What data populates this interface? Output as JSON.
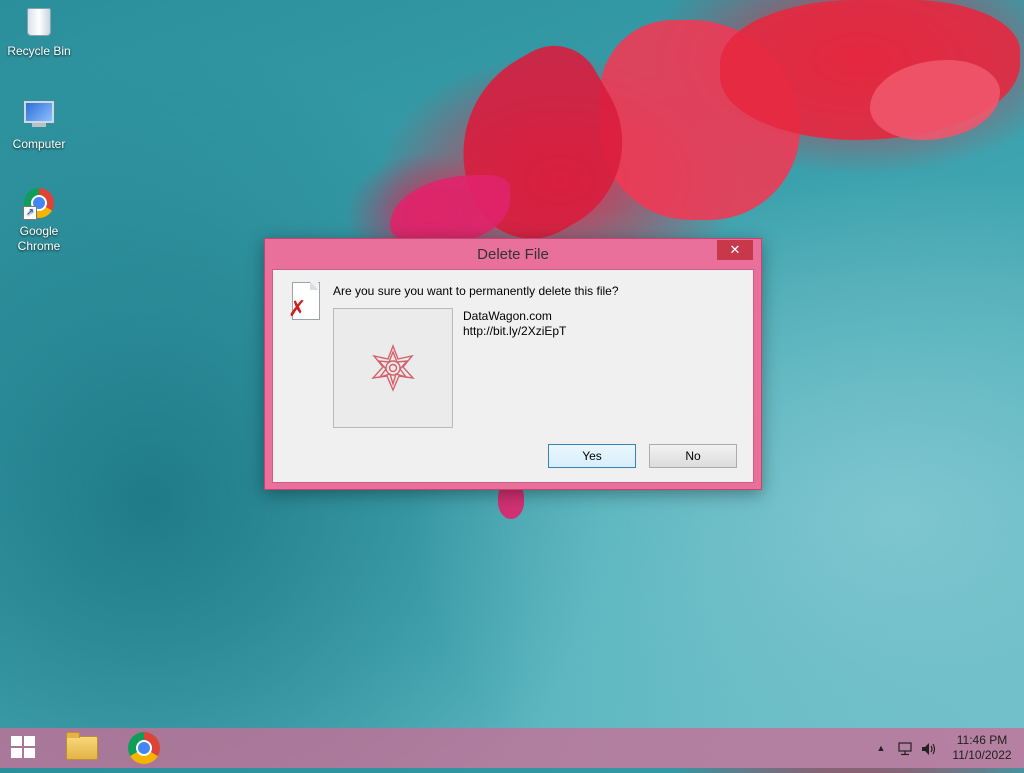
{
  "desktop": {
    "icons": [
      {
        "label": "Recycle Bin",
        "icon": "recycle-bin-icon"
      },
      {
        "label": "Computer",
        "icon": "computer-icon"
      },
      {
        "label": "Google Chrome",
        "icon": "chrome-icon"
      }
    ]
  },
  "dialog": {
    "title": "Delete File",
    "close_label": "✕",
    "question": "Are you sure you want to permanently delete this file?",
    "file_name": "DataWagon.com",
    "file_url": "http://bit.ly/2XziEpT",
    "buttons": {
      "yes": "Yes",
      "no": "No"
    },
    "accent_color": "#e8709a"
  },
  "taskbar": {
    "items": [
      "start-button",
      "file-explorer-icon",
      "chrome-icon"
    ],
    "tray": {
      "chevron": "▲",
      "network": "network-icon",
      "volume": "volume-icon"
    },
    "clock": {
      "time": "11:46 PM",
      "date": "11/10/2022"
    }
  }
}
